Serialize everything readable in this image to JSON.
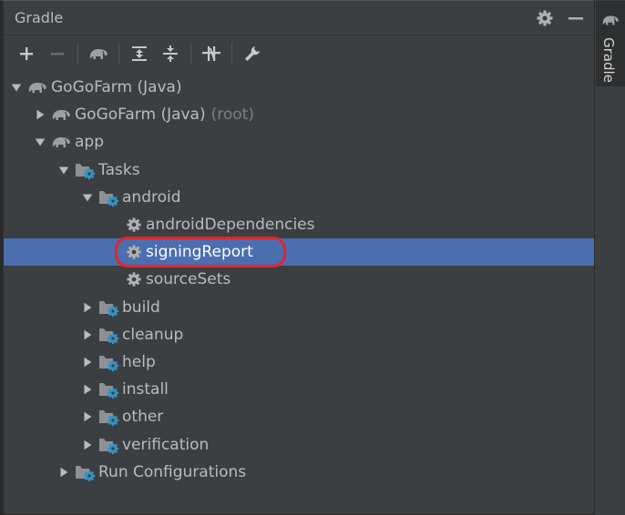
{
  "panel": {
    "title": "Gradle",
    "header_icons": [
      "gear-icon",
      "minimize-icon"
    ]
  },
  "toolbar": {
    "tools": [
      "add-icon",
      "remove-icon",
      "elephant-icon",
      "expand-all-icon",
      "collapse-all-icon",
      "offline-toggle-icon",
      "wrench-icon"
    ]
  },
  "tree": {
    "root": {
      "label": "GoGoFarm (Java)"
    },
    "root_project": {
      "label": "GoGoFarm (Java)",
      "suffix": "(root)"
    },
    "app": {
      "label": "app"
    },
    "tasks": {
      "label": "Tasks"
    },
    "android": {
      "label": "android"
    },
    "task_android_dependencies": {
      "label": "androidDependencies"
    },
    "task_signing_report": {
      "label": "signingReport"
    },
    "task_source_sets": {
      "label": "sourceSets"
    },
    "group_build": {
      "label": "build"
    },
    "group_cleanup": {
      "label": "cleanup"
    },
    "group_help": {
      "label": "help"
    },
    "group_install": {
      "label": "install"
    },
    "group_other": {
      "label": "other"
    },
    "group_verification": {
      "label": "verification"
    },
    "run_configurations": {
      "label": "Run Configurations"
    }
  },
  "sidebar": {
    "tab_label": "Gradle"
  },
  "colors": {
    "background": "#3c3f41",
    "selection": "#4b6eaf",
    "highlight": "#e8222b",
    "text": "#bbbbbb"
  }
}
